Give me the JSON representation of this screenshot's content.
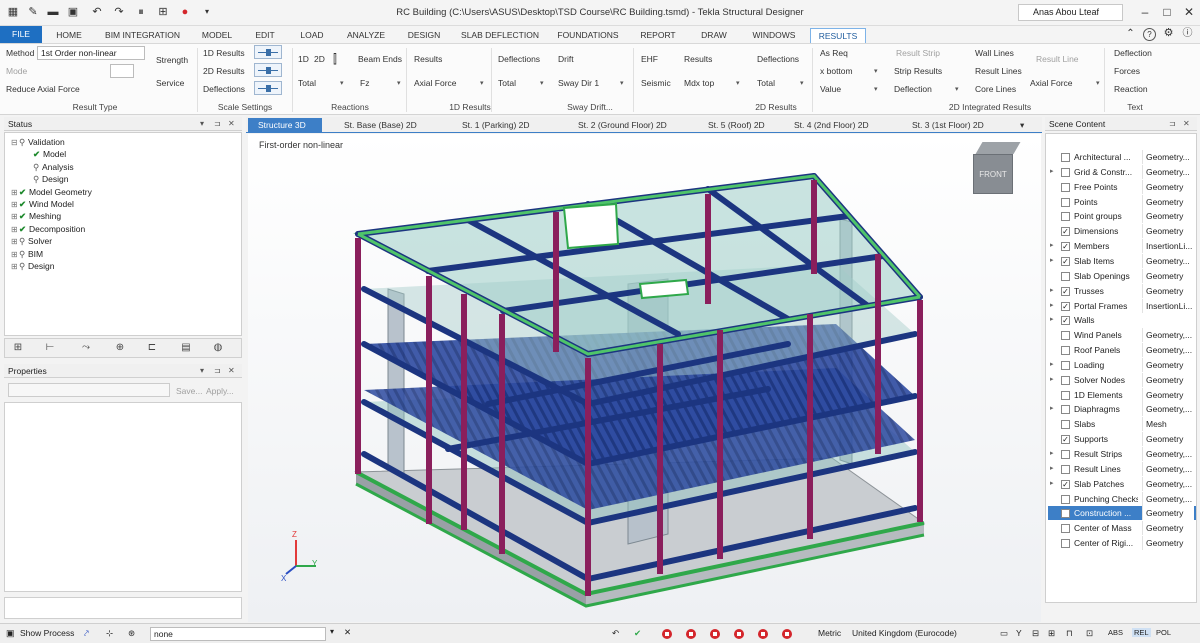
{
  "window": {
    "title": "RC Building (C:\\Users\\ASUS\\Desktop\\TSD Course\\RC Building.tsmd) - Tekla Structural Designer",
    "user": "Anas Abou Lteaf"
  },
  "tabs": {
    "file": "FILE",
    "items": [
      "HOME",
      "BIM INTEGRATION",
      "MODEL",
      "EDIT",
      "LOAD",
      "ANALYZE",
      "DESIGN",
      "SLAB DEFLECTION",
      "FOUNDATIONS",
      "REPORT",
      "DRAW",
      "WINDOWS",
      "RESULTS"
    ],
    "active": "RESULTS"
  },
  "ribbon": {
    "method_label": "Method",
    "method_value": "1st Order non-linear",
    "mode_label": "Mode",
    "reduce_axial": "Reduce Axial Force",
    "strength": "Strength",
    "service": "Service",
    "results_1d": "1D Results",
    "results_2d": "2D Results",
    "deflections": "Deflections",
    "btn_1d": "1D",
    "btn_2d": "2D",
    "beam_ends": "Beam Ends",
    "total": "Total",
    "fz": "Fz",
    "results": "Results",
    "axial_force": "Axial Force",
    "drift": "Drift",
    "sway_dir": "Sway Dir 1",
    "ehf": "EHF",
    "seismic": "Seismic",
    "mdx_top": "Mdx top",
    "as_req": "As Req",
    "x_bottom": "x bottom",
    "value": "Value",
    "result_strip": "Result Strip",
    "strip_results": "Strip Results",
    "deflection": "Deflection",
    "wall_lines": "Wall Lines",
    "result_lines": "Result Lines",
    "core_lines": "Core Lines",
    "result_line": "Result Line",
    "forces": "Forces",
    "reaction": "Reaction",
    "groups": {
      "result_type": "Result Type",
      "scale_settings": "Scale Settings",
      "reactions": "Reactions",
      "results_1d": "1D Results",
      "sway_drift": "Sway Drift...",
      "results_2d": "2D Results",
      "integrated_2d": "2D Integrated Results",
      "text": "Text"
    }
  },
  "status_panel": {
    "title": "Status",
    "tree": [
      {
        "label": "Validation",
        "checked": false,
        "level": 0,
        "expanded": true
      },
      {
        "label": "Model",
        "checked": true,
        "level": 1
      },
      {
        "label": "Analysis",
        "checked": false,
        "level": 1
      },
      {
        "label": "Design",
        "checked": false,
        "level": 1
      },
      {
        "label": "Model Geometry",
        "checked": true,
        "level": 0
      },
      {
        "label": "Wind Model",
        "checked": true,
        "level": 0
      },
      {
        "label": "Meshing",
        "checked": true,
        "level": 0
      },
      {
        "label": "Decomposition",
        "checked": true,
        "level": 0
      },
      {
        "label": "Solver",
        "checked": false,
        "level": 0
      },
      {
        "label": "BIM",
        "checked": false,
        "level": 0
      },
      {
        "label": "Design",
        "checked": false,
        "level": 0
      }
    ]
  },
  "properties_panel": {
    "title": "Properties",
    "save": "Save...",
    "apply": "Apply..."
  },
  "doc_tabs": [
    "Structure 3D",
    "St. Base (Base) 2D",
    "St. 1 (Parking) 2D",
    "St. 2 (Ground Floor) 2D",
    "St. 5 (Roof) 2D",
    "St. 4 (2nd Floor) 2D",
    "St. 3 (1st Floor) 2D"
  ],
  "viewport": {
    "caption": "First-order non-linear",
    "viewcube": "FRONT",
    "axis_z": "Z",
    "axis_y": "Y",
    "axis_x": "X"
  },
  "scene_content": {
    "title": "Scene Content",
    "rows": [
      {
        "name": "Architectural ...",
        "type": "Geometry...",
        "checked": false,
        "expandable": false
      },
      {
        "name": "Grid & Constr...",
        "type": "Geometry...",
        "checked": false,
        "expandable": true
      },
      {
        "name": "Free Points",
        "type": "Geometry",
        "checked": false,
        "expandable": false
      },
      {
        "name": "Points",
        "type": "Geometry",
        "checked": false,
        "expandable": false
      },
      {
        "name": "Point groups",
        "type": "Geometry",
        "checked": false,
        "expandable": false
      },
      {
        "name": "Dimensions",
        "type": "Geometry",
        "checked": true,
        "expandable": false
      },
      {
        "name": "Members",
        "type": "InsertionLi...",
        "checked": true,
        "expandable": true
      },
      {
        "name": "Slab Items",
        "type": "Geometry...",
        "checked": true,
        "expandable": true
      },
      {
        "name": "Slab Openings",
        "type": "Geometry",
        "checked": false,
        "expandable": false
      },
      {
        "name": "Trusses",
        "type": "Geometry",
        "checked": true,
        "expandable": true
      },
      {
        "name": "Portal Frames",
        "type": "InsertionLi...",
        "checked": true,
        "expandable": true
      },
      {
        "name": "Walls",
        "type": "",
        "checked": true,
        "expandable": true
      },
      {
        "name": "Wind Panels",
        "type": "Geometry,...",
        "checked": false,
        "expandable": false
      },
      {
        "name": "Roof Panels",
        "type": "Geometry,...",
        "checked": false,
        "expandable": false
      },
      {
        "name": "Loading",
        "type": "Geometry",
        "checked": false,
        "expandable": true
      },
      {
        "name": "Solver Nodes",
        "type": "Geometry",
        "checked": false,
        "expandable": true
      },
      {
        "name": "1D Elements",
        "type": "Geometry",
        "checked": false,
        "expandable": false
      },
      {
        "name": "Diaphragms",
        "type": "Geometry,...",
        "checked": false,
        "expandable": true
      },
      {
        "name": "Slabs",
        "type": "Mesh",
        "checked": false,
        "expandable": false
      },
      {
        "name": "Supports",
        "type": "Geometry",
        "checked": true,
        "expandable": false
      },
      {
        "name": "Result Strips",
        "type": "Geometry,...",
        "checked": false,
        "expandable": true
      },
      {
        "name": "Result Lines",
        "type": "Geometry,...",
        "checked": false,
        "expandable": true
      },
      {
        "name": "Slab Patches",
        "type": "Geometry,...",
        "checked": true,
        "expandable": true
      },
      {
        "name": "Punching Checks",
        "type": "Geometry,...",
        "checked": false,
        "expandable": false
      },
      {
        "name": "Construction ...",
        "type": "Geometry",
        "checked": false,
        "expandable": false,
        "selected": true
      },
      {
        "name": "Center of Mass",
        "type": "Geometry",
        "checked": false,
        "expandable": false
      },
      {
        "name": "Center of Rigi...",
        "type": "Geometry",
        "checked": false,
        "expandable": false
      }
    ]
  },
  "statusbar": {
    "show_process": "Show Process",
    "filter_value": "none",
    "units": "Metric",
    "region": "United Kingdom (Eurocode)",
    "abs": "ABS",
    "rel": "REL",
    "pol": "POL"
  },
  "colors": {
    "accent": "#1e6fc2",
    "column": "#8a1f5c",
    "beam": "#1c3580",
    "slab": "#8fc4bf",
    "support": "#2fa84a"
  }
}
